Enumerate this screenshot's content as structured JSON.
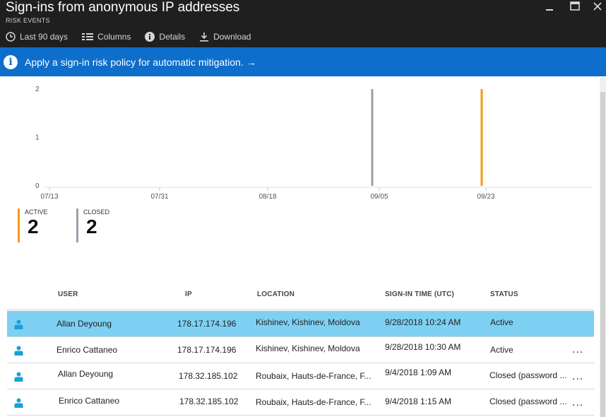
{
  "header": {
    "title": "Sign-ins from anonymous IP addresses",
    "subtitle": "RISK EVENTS",
    "toolbar": {
      "range_label": "Last 90 days",
      "columns_label": "Columns",
      "details_label": "Details",
      "download_label": "Download"
    }
  },
  "banner": {
    "text": "Apply a sign-in risk policy for automatic mitigation.",
    "arrow": "→",
    "info_glyph": "i"
  },
  "chart_data": {
    "type": "bar",
    "x": [
      "07/13",
      "07/31",
      "08/18",
      "09/05",
      "09/23"
    ],
    "y_ticks": [
      0,
      1,
      2
    ],
    "ylim": [
      0,
      2
    ],
    "series": [
      {
        "name": "CLOSED",
        "color": "#9aa1a9",
        "points": [
          {
            "x": "09/05",
            "y": 2
          }
        ]
      },
      {
        "name": "ACTIVE",
        "color": "#f39c12",
        "points": [
          {
            "x": "09/23",
            "y": 2
          }
        ]
      }
    ]
  },
  "summary": {
    "active": {
      "label": "ACTIVE",
      "value": "2",
      "color": "#f39c12"
    },
    "closed": {
      "label": "CLOSED",
      "value": "2",
      "color": "#9aa1a9"
    }
  },
  "table": {
    "headers": {
      "user": "USER",
      "ip": "IP",
      "location": "LOCATION",
      "time": "SIGN-IN TIME (UTC)",
      "status": "STATUS"
    },
    "more_glyph": "...",
    "rows": [
      {
        "user": "Allan Deyoung",
        "ip": "178.17.174.196",
        "location": "Kishinev, Kishinev, Moldova",
        "time": "9/28/2018 10:24 AM",
        "status": "Active",
        "selected": true,
        "more": false
      },
      {
        "user": "Enrico Cattaneo",
        "ip": "178.17.174.196",
        "location": "Kishinev, Kishinev, Moldova",
        "time": "9/28/2018 10:30 AM",
        "status": "Active",
        "selected": false,
        "more": true
      },
      {
        "user": "Allan Deyoung",
        "ip": "178.32.185.102",
        "location": "Roubaix, Hauts-de-France, F...",
        "time": "9/4/2018 1:09 AM",
        "status": "Closed (password ...",
        "selected": false,
        "more": true
      },
      {
        "user": "Enrico Cattaneo",
        "ip": "178.32.185.102",
        "location": "Roubaix, Hauts-de-France, F...",
        "time": "9/4/2018 1:15 AM",
        "status": "Closed (password ...",
        "selected": false,
        "more": true
      }
    ]
  },
  "icons": {
    "clock": "clock-icon",
    "columns": "columns-icon",
    "info": "info-icon",
    "download": "download-icon",
    "user": "user-icon"
  },
  "colors": {
    "header_bg": "#1f1f1f",
    "banner_bg": "#0d6ecb",
    "selected_row": "#7ed0f3",
    "user_icon": "#1aa0d8"
  }
}
